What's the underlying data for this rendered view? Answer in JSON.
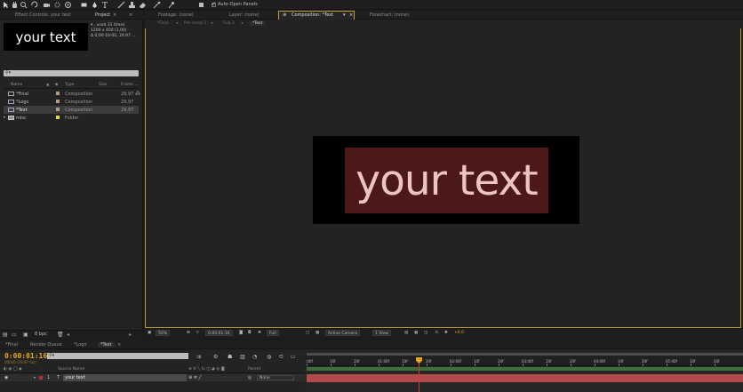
{
  "toolbar": {
    "tools": [
      "selection-tool",
      "hand-tool",
      "zoom-tool",
      "rotation-tool",
      "camera-tool",
      "pan-behind-tool",
      "rectangle-tool",
      "pen-tool",
      "type-tool",
      "brush-tool",
      "clone-stamp-tool",
      "eraser-tool",
      "roto-brush-tool",
      "puppet-tool"
    ],
    "auto_open_label": "Auto-Open Panels"
  },
  "left_tabs": {
    "effect_controls": "Effect Controls: your text",
    "project": "Project",
    "close": "×"
  },
  "project": {
    "thumb_text": "your text",
    "info_line1": "▾ , used 31 times",
    "info_line2": "1200 x 400 (1,00)",
    "info_line3": "Δ 0;00:10:00, 29,97 ...",
    "search_placeholder": "⚲▾",
    "columns": [
      "Name",
      "Type",
      "Size",
      "Frame ..."
    ],
    "rows": [
      {
        "name": "*Final",
        "type": "Composition",
        "frame": "29,97",
        "color": "#b59d7c",
        "icon": "composition-icon"
      },
      {
        "name": "*Logo",
        "type": "Composition",
        "frame": "29,97",
        "color": "#b59d7c",
        "icon": "composition-icon"
      },
      {
        "name": "*Text",
        "type": "Composition",
        "frame": "29,97",
        "color": "#b59d7c",
        "icon": "composition-icon"
      },
      {
        "name": "misc",
        "type": "Folder",
        "frame": "",
        "color": "#e6d83a",
        "icon": "folder-icon"
      }
    ],
    "bpc_label": "8 bpc"
  },
  "comp_tabs": {
    "footage": "Footage: (none)",
    "layer": "Layer: (none)",
    "composition": "Composition: *Text",
    "flowchart": "Flowchart: (none)"
  },
  "breadcrumbs": [
    "*Final",
    "Pre-comp 1",
    "Sub 2",
    "*Text"
  ],
  "comp": {
    "text": "your text",
    "text_color": "#ecc4c0",
    "text_bg": "#4c1818"
  },
  "viewer_bar": {
    "zoom": "50%",
    "timecode": "0:00:01:16",
    "resolution": "Full",
    "camera": "Active Camera",
    "views": "1 View",
    "exposure": "+0,0"
  },
  "timeline": {
    "tabs": [
      "*Final",
      "Render Queue",
      "*Logo",
      "*Text"
    ],
    "timecode": "0:00:01:16",
    "fps_line": "00046 (29.97 fps)",
    "search_placeholder": "⚲▾",
    "col_source_name": "Source Name",
    "col_parent": "Parent",
    "layer_name": "your text",
    "parent_value": "None",
    "ruler_ticks": [
      ":00f",
      "10f",
      "20f",
      "01:00f",
      "10f",
      "20f",
      "02:00f",
      "10f",
      "20f",
      "03:00f",
      "10f",
      "20f",
      "04:00f",
      "10f",
      "20f",
      "05:00f",
      "10f",
      "20f"
    ]
  }
}
